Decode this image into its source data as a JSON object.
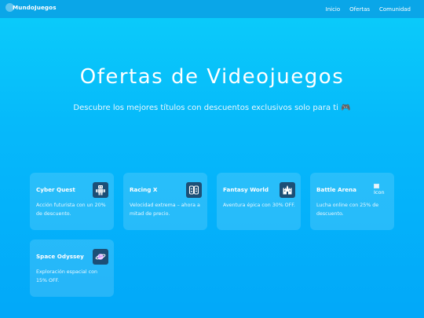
{
  "nav": {
    "brand": "MundoJuegos",
    "links": [
      "Inicio",
      "Ofertas",
      "Comunidad"
    ]
  },
  "hero": {
    "title": "Ofertas de Videojuegos",
    "subtitle": "Descubre los mejores títulos con descuentos exclusivos solo para ti 🎮"
  },
  "cards": [
    {
      "title": "Cyber Quest",
      "icon": "robot-icon",
      "description": "Acción futurista con un 20% de descuento."
    },
    {
      "title": "Racing X",
      "icon": "gamepad-icon",
      "description": "Velocidad extrema – ahora a mitad de precio."
    },
    {
      "title": "Fantasy World",
      "icon": "castle-icon",
      "description": "Aventura épica con 30% OFF."
    },
    {
      "title": "Battle Arena",
      "icon": "broken-image-icon",
      "icon_alt": "Icon",
      "description": "Lucha online con 25% de descuento."
    },
    {
      "title": "Space Odyssey",
      "icon": "planet-icon",
      "description": "Exploración espacial con 15% OFF."
    }
  ],
  "colors": {
    "background_top": "#0bcdfa",
    "background_bottom": "#02a8f9",
    "navbar": "#0aa6e8",
    "icon_tile": "#1c4f76"
  }
}
